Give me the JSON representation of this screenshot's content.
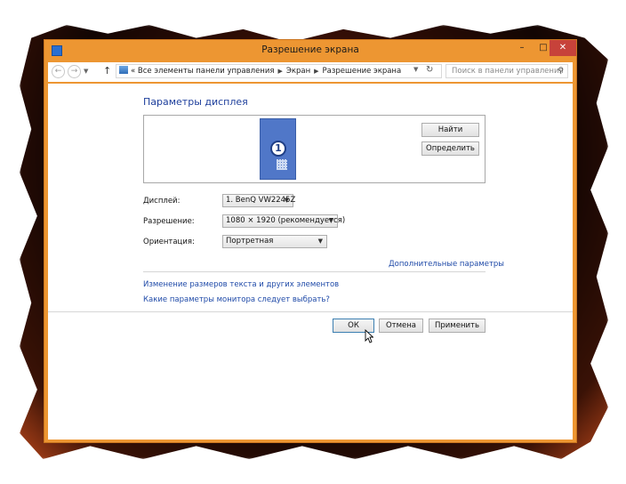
{
  "window": {
    "title": "Разрешение экрана",
    "controls": {
      "minimize": "–",
      "maximize": "□",
      "close": "✕"
    }
  },
  "nav": {
    "back": "←",
    "forward": "→",
    "up": "↑",
    "breadcrumb_prefix": "«",
    "breadcrumb": [
      "Все элементы панели управления",
      "Экран",
      "Разрешение экрана"
    ],
    "search_placeholder": "Поиск в панели управления"
  },
  "display_settings": {
    "heading": "Параметры дисплея",
    "monitor_number": "1",
    "find_button": "Найти",
    "identify_button": "Определить",
    "display_label": "Дисплей:",
    "display_value": "1. BenQ VW2245Z",
    "resolution_label": "Разрешение:",
    "resolution_value": "1080 × 1920 (рекомендуется)",
    "orientation_label": "Ориентация:",
    "orientation_value": "Портретная",
    "advanced_link": "Дополнительные параметры",
    "text_size_link": "Изменение размеров текста и других элементов",
    "monitor_help_link": "Какие параметры монитора следует выбрать?"
  },
  "footer": {
    "ok": "ОК",
    "cancel": "Отмена",
    "apply": "Применить"
  },
  "colors": {
    "window_frame": "#ed9632",
    "close_button": "#c7423a",
    "link": "#1f4aa8",
    "heading": "#1e3f9c",
    "monitor": "#5077c8"
  }
}
